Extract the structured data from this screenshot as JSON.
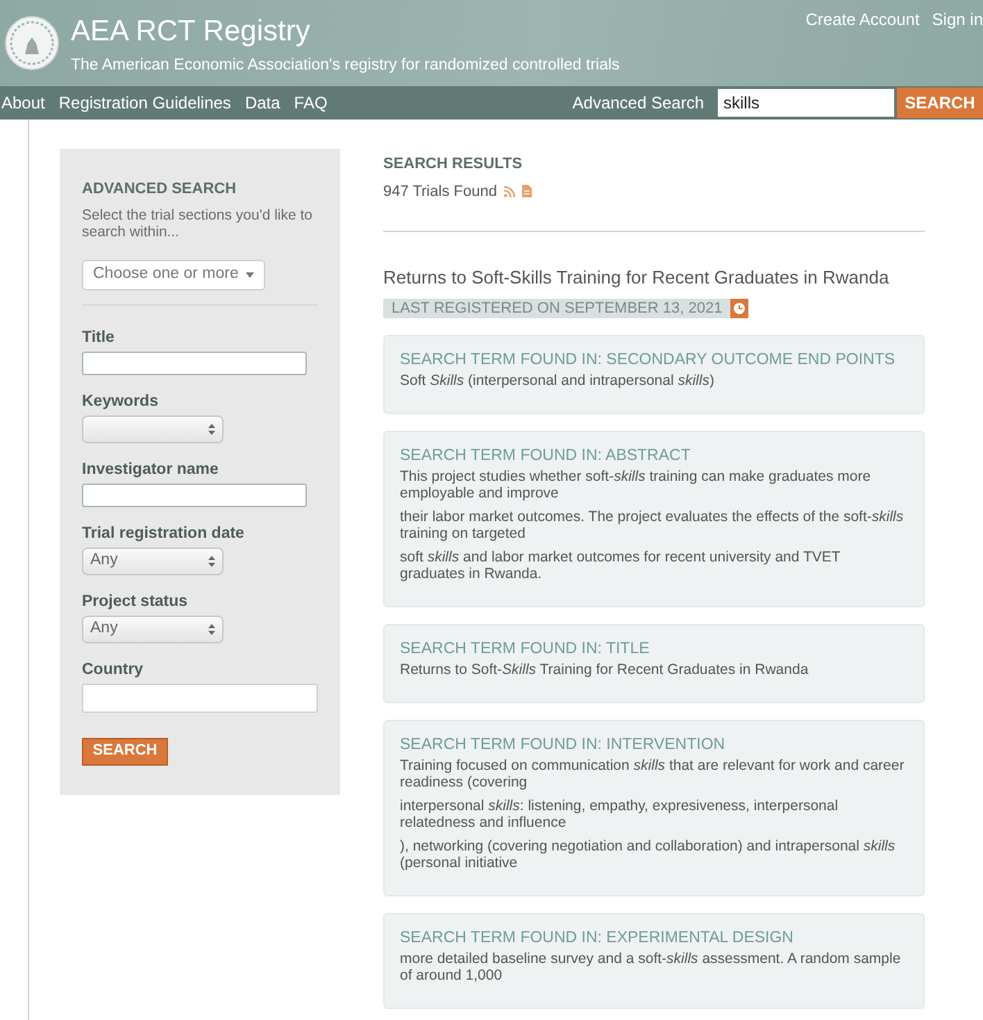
{
  "header": {
    "title": "AEA RCT Registry",
    "subtitle": "The American Economic Association's registry for randomized controlled trials",
    "account_links": [
      "Create Account",
      "Sign in"
    ]
  },
  "nav": {
    "links": [
      "About",
      "Registration Guidelines",
      "Data",
      "FAQ"
    ],
    "advanced_search": "Advanced Search",
    "search_value": "skills",
    "search_button": "SEARCH"
  },
  "sidebar": {
    "heading": "ADVANCED SEARCH",
    "description": "Select the trial sections you'd like to search within...",
    "sections_dropdown": "Choose one or more",
    "fields": [
      {
        "kind": "text",
        "label": "Title"
      },
      {
        "kind": "select",
        "label": "Keywords"
      },
      {
        "kind": "text",
        "label": "Investigator name"
      },
      {
        "kind": "select",
        "label": "Trial registration date",
        "value": "Any"
      },
      {
        "kind": "select",
        "label": "Project status",
        "value": "Any"
      },
      {
        "kind": "wide",
        "label": "Country"
      }
    ],
    "button": "SEARCH"
  },
  "results": {
    "heading": "SEARCH RESULTS",
    "count": "947 Trials Found",
    "trial_title": "Returns to Soft-Skills Training for Recent Graduates in Rwanda",
    "last_registered": "LAST REGISTERED ON SEPTEMBER 13, 2021",
    "matches": [
      {
        "heading": "SEARCH TERM FOUND IN: SECONDARY OUTCOME END POINTS",
        "paragraphs": [
          "Soft *Skills* (interpersonal and intrapersonal *skills*)"
        ]
      },
      {
        "heading": "SEARCH TERM FOUND IN: ABSTRACT",
        "paragraphs": [
          "This project studies whether soft-*skills* training can make graduates more employable and improve",
          "their labor market outcomes. The project evaluates the effects of the soft-*skills* training on targeted",
          "soft *skills* and labor market outcomes for recent university and TVET graduates in Rwanda."
        ]
      },
      {
        "heading": "SEARCH TERM FOUND IN: TITLE",
        "paragraphs": [
          "Returns to Soft-*Skills* Training for Recent Graduates in Rwanda"
        ]
      },
      {
        "heading": "SEARCH TERM FOUND IN: INTERVENTION",
        "paragraphs": [
          "Training focused on communication *skills* that are relevant for work and career readiness (covering",
          "interpersonal *skills*: listening, empathy, expresiveness, interpersonal relatedness and influence",
          "), networking (covering negotiation and collaboration) and intrapersonal *skills* (personal initiative"
        ]
      },
      {
        "heading": "SEARCH TERM FOUND IN: EXPERIMENTAL DESIGN",
        "paragraphs": [
          "more detailed baseline survey and a soft-*skills* assessment. A random sample of around 1,000"
        ]
      }
    ]
  }
}
